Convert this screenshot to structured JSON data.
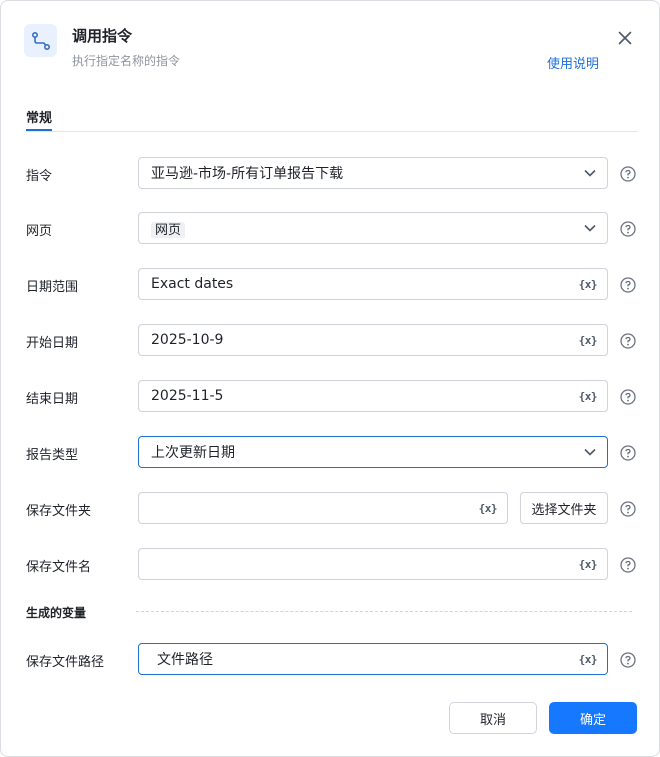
{
  "dialog": {
    "title": "调用指令",
    "subtitle": "执行指定名称的指令",
    "help_link": "使用说明",
    "icon": "flow-route-icon",
    "close_icon": "close-icon"
  },
  "tabs": [
    {
      "label": "常规",
      "active": true
    }
  ],
  "fields": {
    "command": {
      "label": "指令",
      "value": "亚马逊-市场-所有订单报告下载",
      "type": "select"
    },
    "webpage": {
      "label": "网页",
      "value": "网页",
      "type": "select-tag"
    },
    "date_range": {
      "label": "日期范围",
      "value": "Exact dates",
      "type": "variable-input"
    },
    "start_date": {
      "label": "开始日期",
      "value": "2025-10-9",
      "type": "variable-input"
    },
    "end_date": {
      "label": "结束日期",
      "value": "2025-11-5",
      "type": "variable-input"
    },
    "report_type": {
      "label": "报告类型",
      "value": "上次更新日期",
      "type": "select"
    },
    "save_folder": {
      "label": "保存文件夹",
      "value": "",
      "type": "variable-input",
      "button": "选择文件夹"
    },
    "save_filename": {
      "label": "保存文件名",
      "value": "",
      "type": "variable-input"
    }
  },
  "generated_vars": {
    "section_title": "生成的变量",
    "save_path": {
      "label": "保存文件路径",
      "value": "文件路径"
    }
  },
  "variable_icon_text": "{x}",
  "footer": {
    "cancel": "取消",
    "ok": "确定"
  },
  "colors": {
    "accent": "#1677ff",
    "link": "#1e6fd9",
    "border": "#d0d3d9"
  }
}
